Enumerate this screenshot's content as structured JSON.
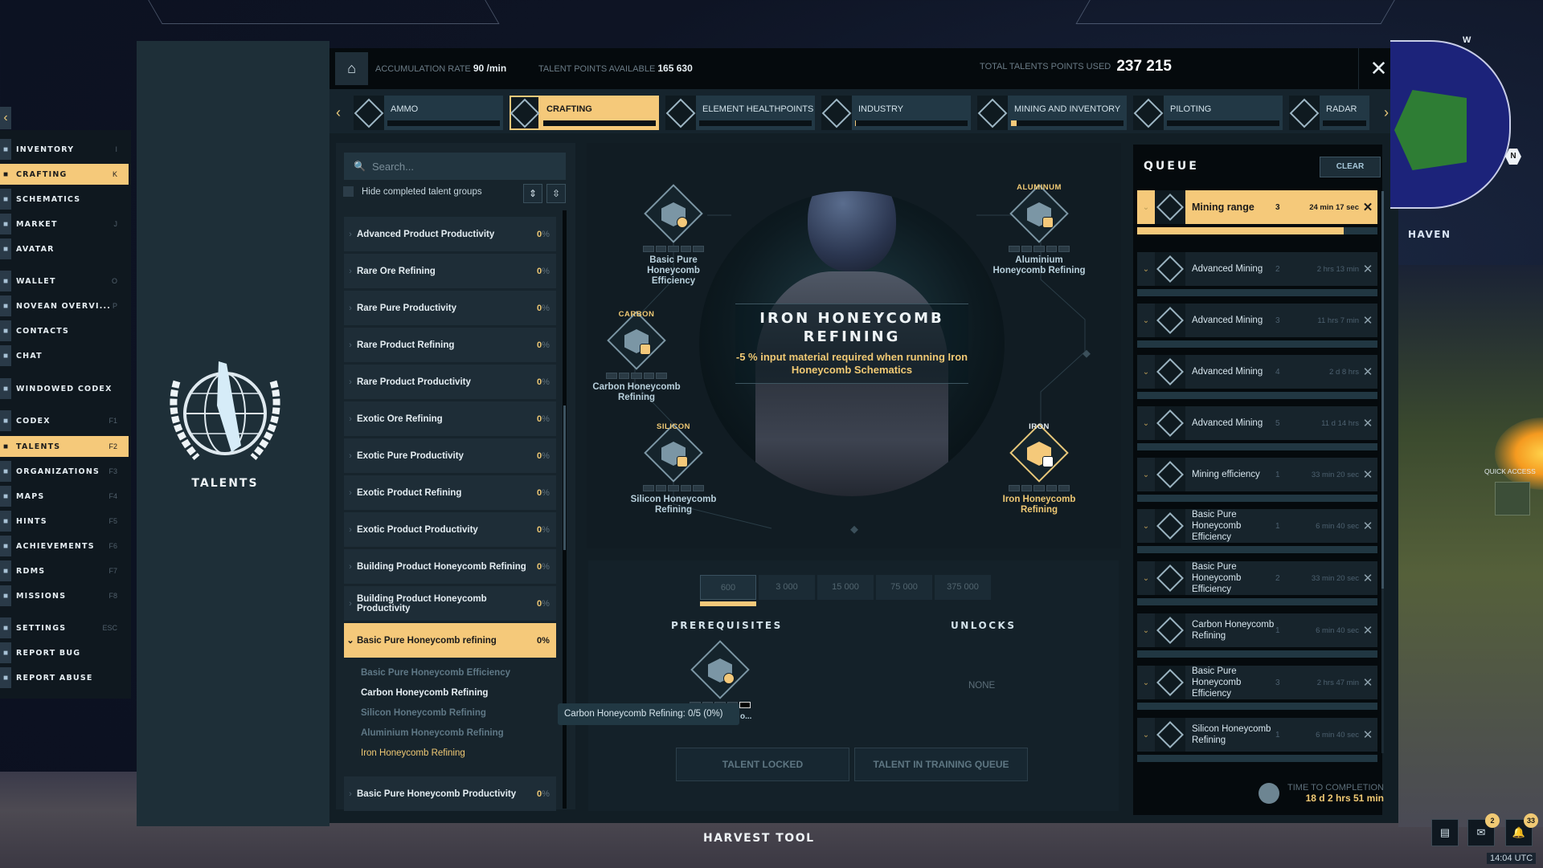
{
  "menu": {
    "items": [
      {
        "label": "INVENTORY",
        "key": "I",
        "icon": "inventory-icon"
      },
      {
        "label": "CRAFTING",
        "key": "K",
        "icon": "crafting-icon",
        "active": true
      },
      {
        "label": "SCHEMATICS",
        "key": "",
        "icon": "schematics-icon"
      },
      {
        "label": "MARKET",
        "key": "J",
        "icon": "market-icon"
      },
      {
        "label": "AVATAR",
        "key": "",
        "icon": "avatar-icon"
      },
      {
        "label": "WALLET",
        "key": "O",
        "icon": "wallet-icon"
      },
      {
        "label": "NOVEAN OVERVI...",
        "key": "P",
        "icon": "overview-icon"
      },
      {
        "label": "CONTACTS",
        "key": "",
        "icon": "contacts-icon"
      },
      {
        "label": "CHAT",
        "key": "",
        "icon": "chat-icon"
      },
      {
        "label": "WINDOWED CODEX",
        "key": "",
        "icon": "codex-window-icon"
      },
      {
        "label": "CODEX",
        "key": "F1",
        "icon": "codex-icon"
      },
      {
        "label": "TALENTS",
        "key": "F2",
        "icon": "talents-icon",
        "active": true
      },
      {
        "label": "ORGANIZATIONS",
        "key": "F3",
        "icon": "organizations-icon"
      },
      {
        "label": "MAPS",
        "key": "F4",
        "icon": "maps-icon"
      },
      {
        "label": "HINTS",
        "key": "F5",
        "icon": "hints-icon"
      },
      {
        "label": "ACHIEVEMENTS",
        "key": "F6",
        "icon": "achievements-icon"
      },
      {
        "label": "RDMS",
        "key": "F7",
        "icon": "rdms-icon"
      },
      {
        "label": "MISSIONS",
        "key": "F8",
        "icon": "missions-icon"
      },
      {
        "label": "SETTINGS",
        "key": "ESC",
        "icon": "settings-icon"
      },
      {
        "label": "REPORT BUG",
        "key": "",
        "icon": "bug-icon"
      },
      {
        "label": "REPORT ABUSE",
        "key": "",
        "icon": "abuse-icon"
      }
    ]
  },
  "panel": {
    "title": "TALENTS"
  },
  "header": {
    "accumulation_label": "ACCUMULATION RATE",
    "accumulation_value": "90 /min",
    "available_label": "TALENT POINTS AVAILABLE",
    "available_value": "165 630",
    "used_label": "TOTAL TALENTS POINTS USED",
    "used_value": "237 215",
    "close": "✕",
    "home": "⌂"
  },
  "tabs": [
    {
      "label": "AMMO",
      "progress": 0
    },
    {
      "label": "CRAFTING",
      "progress": 0,
      "active": true
    },
    {
      "label": "ELEMENT HEALTHPOINTS",
      "progress": 0
    },
    {
      "label": "INDUSTRY",
      "progress": 1
    },
    {
      "label": "MINING AND INVENTORY",
      "progress": 5
    },
    {
      "label": "PILOTING",
      "progress": 0
    },
    {
      "label": "RADAR",
      "progress": 0
    }
  ],
  "talent_list": {
    "search_placeholder": "Search...",
    "hide_completed_label": "Hide completed talent groups",
    "groups": [
      {
        "name": "Advanced Product Productivity",
        "pct": "0"
      },
      {
        "name": "Rare Ore Refining",
        "pct": "0"
      },
      {
        "name": "Rare Pure Productivity",
        "pct": "0"
      },
      {
        "name": "Rare Product Refining",
        "pct": "0"
      },
      {
        "name": "Rare Product Productivity",
        "pct": "0"
      },
      {
        "name": "Exotic Ore Refining",
        "pct": "0"
      },
      {
        "name": "Exotic Pure Productivity",
        "pct": "0"
      },
      {
        "name": "Exotic Product Refining",
        "pct": "0"
      },
      {
        "name": "Exotic Product Productivity",
        "pct": "0"
      },
      {
        "name": "Building Product Honeycomb Refining",
        "pct": "0"
      },
      {
        "name": "Building Product Honeycomb Productivity",
        "pct": "0"
      },
      {
        "name": "Basic Pure Honeycomb refining",
        "pct": "0",
        "open": true
      },
      {
        "name": "Basic Pure Honeycomb Productivity",
        "pct": "0"
      }
    ],
    "open_group_items": [
      {
        "name": "Basic Pure Honeycomb Efficiency",
        "state": "dim"
      },
      {
        "name": "Carbon Honeycomb Refining",
        "state": "bright"
      },
      {
        "name": "Silicon Honeycomb Refining",
        "state": "dim"
      },
      {
        "name": "Aluminium Honeycomb Refining",
        "state": "dim"
      },
      {
        "name": "Iron Honeycomb Refining",
        "state": "selected"
      }
    ],
    "pct_symbol": "%"
  },
  "graph": {
    "selected_title": "IRON HONEYCOMB REFINING",
    "selected_description": "-5 % input material required when running Iron Honeycomb Schematics",
    "nodes": [
      {
        "label": "Basic Pure Honeycomb Efficiency",
        "material": "",
        "badge": "timer"
      },
      {
        "label": "Carbon Honeycomb Refining",
        "material": "CARBON",
        "badge": "minus"
      },
      {
        "label": "Silicon Honeycomb Refining",
        "material": "SILICON",
        "badge": "minus"
      },
      {
        "label": "Aluminium Honeycomb Refining",
        "material": "ALUMINUM",
        "badge": "minus"
      },
      {
        "label": "Iron Honeycomb Refining",
        "material": "IRON",
        "badge": "minus",
        "selected": true
      }
    ]
  },
  "detail": {
    "levels": [
      "600",
      "3 000",
      "15 000",
      "75 000",
      "375 000"
    ],
    "selected_level": 0,
    "prerequisites_label": "PREREQUISITES",
    "unlocks_label": "UNLOCKS",
    "unlocks_value": "NONE",
    "prereq_truncated": "o...",
    "tooltip": "Carbon Honeycomb Refining: 0/5 (0%)",
    "locked_button": "TALENT LOCKED",
    "queue_button": "TALENT IN TRAINING QUEUE"
  },
  "queue": {
    "title": "QUEUE",
    "clear_label": "CLEAR",
    "items": [
      {
        "name": "Mining range",
        "level": "3",
        "time": "24 min 17 sec",
        "progress": 0.86,
        "active": true,
        "icon": "mining-icon"
      },
      {
        "name": "Advanced Mining",
        "level": "2",
        "time": "2 hrs 13 min",
        "progress": 0,
        "icon": "mining-icon"
      },
      {
        "name": "Advanced Mining",
        "level": "3",
        "time": "11 hrs 7 min",
        "progress": 0,
        "icon": "mining-icon"
      },
      {
        "name": "Advanced Mining",
        "level": "4",
        "time": "2 d 8 hrs",
        "progress": 0,
        "icon": "mining-icon"
      },
      {
        "name": "Advanced Mining",
        "level": "5",
        "time": "11 d 14 hrs",
        "progress": 0,
        "icon": "mining-icon"
      },
      {
        "name": "Mining efficiency",
        "level": "1",
        "time": "33 min 20 sec",
        "progress": 0,
        "icon": "mining-icon"
      },
      {
        "name": "Basic Pure Honeycomb Efficiency",
        "level": "1",
        "time": "6 min 40 sec",
        "progress": 0,
        "icon": "crafting-icon"
      },
      {
        "name": "Basic Pure Honeycomb Efficiency",
        "level": "2",
        "time": "33 min 20 sec",
        "progress": 0,
        "icon": "crafting-icon"
      },
      {
        "name": "Carbon Honeycomb Refining",
        "level": "1",
        "time": "6 min 40 sec",
        "progress": 0,
        "icon": "crafting-icon"
      },
      {
        "name": "Basic Pure Honeycomb Efficiency",
        "level": "3",
        "time": "2 hrs 47 min",
        "progress": 0,
        "icon": "crafting-icon"
      },
      {
        "name": "Silicon Honeycomb Refining",
        "level": "1",
        "time": "6 min 40 sec",
        "progress": 0,
        "icon": "crafting-icon"
      }
    ],
    "completion_label": "TIME TO COMPLETION",
    "completion_value": "18 d 2 hrs 51 min"
  },
  "hud": {
    "location": "HAVEN",
    "compass_w": "W",
    "compass_n": "N",
    "quick_access": "QUICK ACCESS",
    "tool": "HARVEST TOOL",
    "chat_badge": "2",
    "notif_badge": "33",
    "time": "14:04 UTC"
  },
  "colors": {
    "accent": "#f5c97a",
    "panel": "#121e25",
    "queue_bg": "#050a0d"
  }
}
